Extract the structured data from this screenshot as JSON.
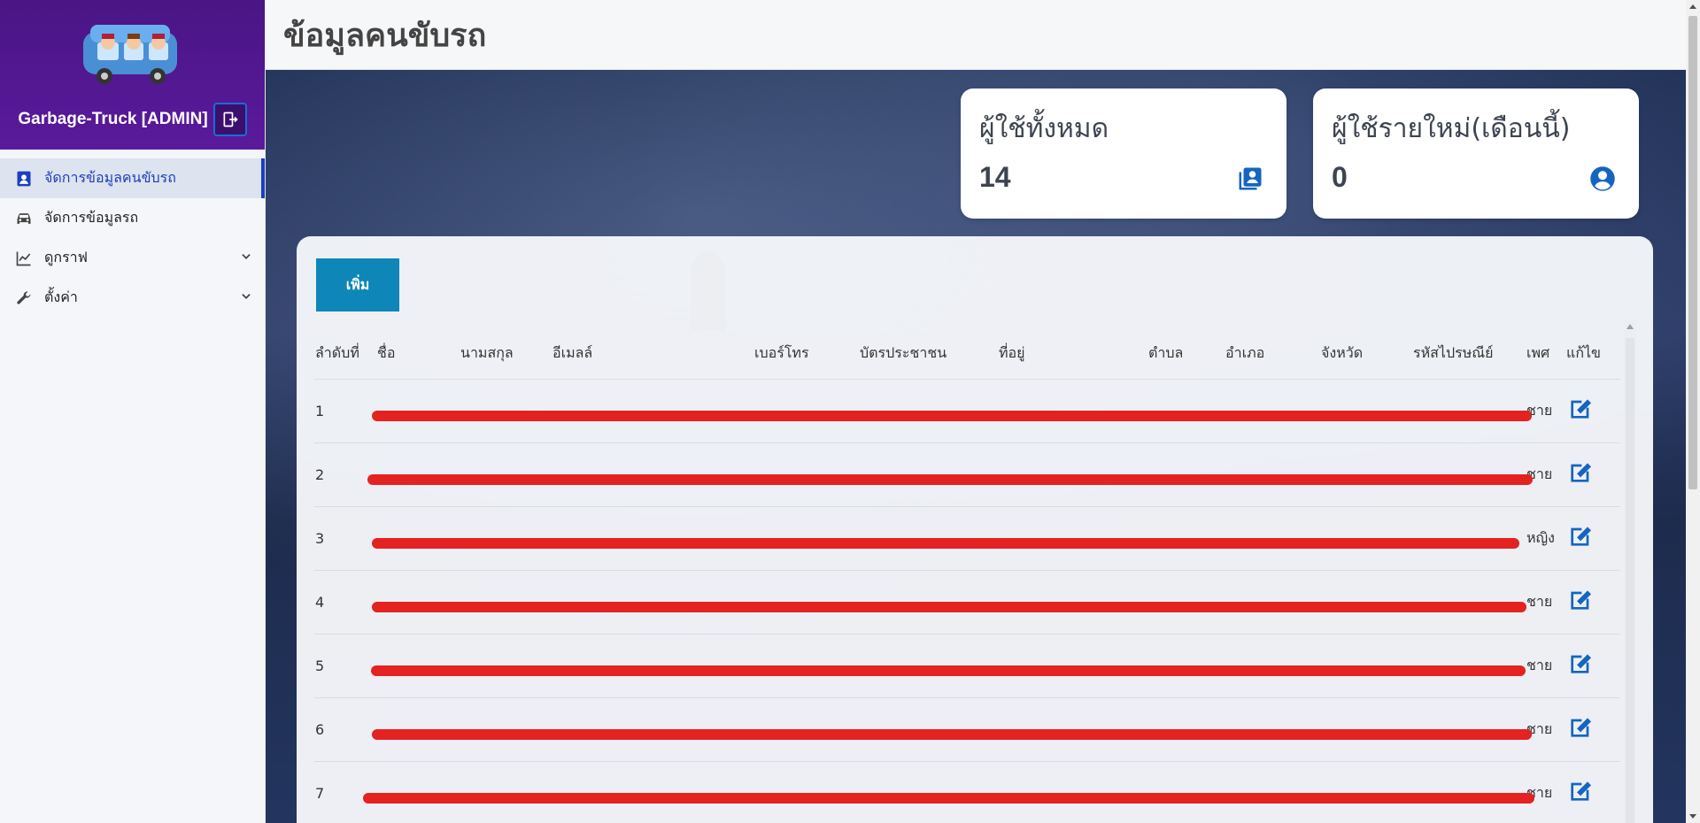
{
  "sidebar": {
    "brand": "Garbage-Truck [ADMIN]",
    "items": [
      {
        "label": "จัดการข้อมูลคนขับรถ",
        "icon": "contact-card-icon",
        "active": true
      },
      {
        "label": "จัดการข้อมูลรถ",
        "icon": "car-icon",
        "active": false
      },
      {
        "label": "ดูกราฟ",
        "icon": "line-chart-icon",
        "active": false,
        "expandable": true
      },
      {
        "label": "ตั้งค่า",
        "icon": "wrench-icon",
        "active": false,
        "expandable": true
      }
    ]
  },
  "header": {
    "title": "ข้อมูลคนขับรถ"
  },
  "stats": {
    "total": {
      "label": "ผู้ใช้ทั้งหมด",
      "value": "14",
      "icon": "contacts-book-icon"
    },
    "new": {
      "label": "ผู้ใช้รายใหม่(เดือนนี้)",
      "value": "0",
      "icon": "account-circle-icon"
    }
  },
  "panel": {
    "add_label": "เพิ่ม",
    "columns": [
      "ลำดับที่",
      "ชื่อ",
      "นามสกุล",
      "อีเมลล์",
      "เบอร์โทร",
      "บัตรประชาชน",
      "ที่อยู่",
      "ตำบล",
      "อำเภอ",
      "จังหวัด",
      "รหัสไปรษณีย์",
      "เพศ",
      "แก้ไข"
    ],
    "rows": [
      {
        "no": "1",
        "gender": "ชาย"
      },
      {
        "no": "2",
        "gender": "ชาย"
      },
      {
        "no": "3",
        "gender": "หญิง"
      },
      {
        "no": "4",
        "gender": "ชาย"
      },
      {
        "no": "5",
        "gender": "ชาย"
      },
      {
        "no": "6",
        "gender": "ชาย"
      },
      {
        "no": "7",
        "gender": "ชาย"
      }
    ]
  },
  "colors": {
    "accent": "#1a3fbf",
    "sidebar_head": "#4a1585",
    "add_button": "#0f86b8",
    "redaction": "#e42222",
    "icon_blue": "#1565c0"
  }
}
